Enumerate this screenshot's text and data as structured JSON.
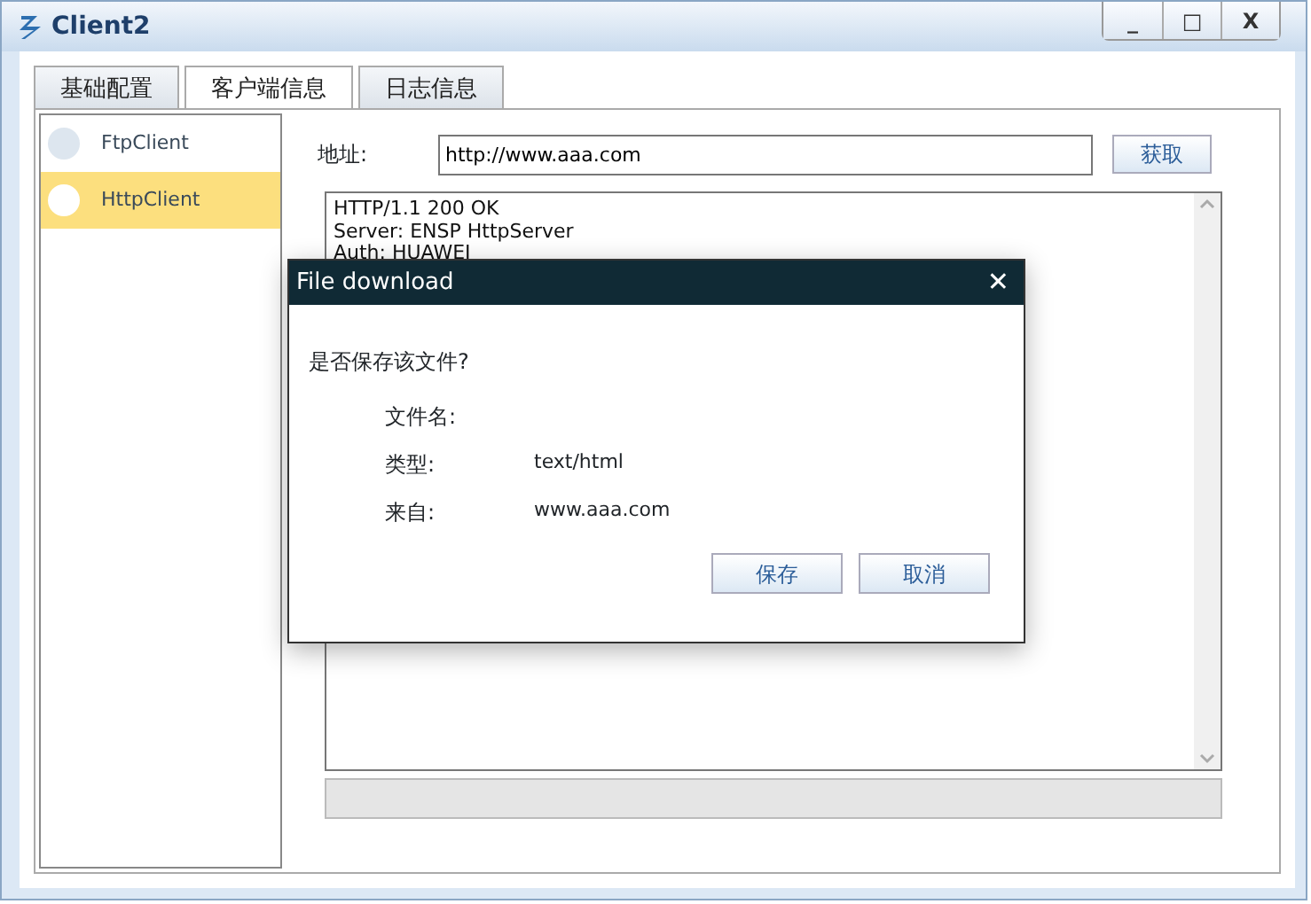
{
  "window": {
    "title": "Client2",
    "controls": [
      "_",
      "□",
      "X"
    ]
  },
  "tabs": [
    {
      "label": "基础配置",
      "selected": false
    },
    {
      "label": "客户端信息",
      "selected": true
    },
    {
      "label": "日志信息",
      "selected": false
    }
  ],
  "clients": [
    {
      "label": "FtpClient",
      "selected": false
    },
    {
      "label": "HttpClient",
      "selected": true
    }
  ],
  "address": {
    "label": "地址:",
    "value": "http://www.aaa.com"
  },
  "fetch_button": "获取",
  "progress": {
    "level": 0
  },
  "response_lines": [
    "HTTP/1.1 200 OK",
    "Server: ENSP HttpServer",
    "Auth: HUAWEI"
  ],
  "dialog": {
    "title": "File download",
    "close": "✕",
    "question": "是否保存该文件?",
    "fields": [
      {
        "label": "文件名:"
      },
      {
        "label": "类型:",
        "value": "text/html"
      },
      {
        "label": "来自:",
        "value": "www.aaa.com"
      }
    ],
    "buttons": [
      "保存",
      "取消"
    ]
  }
}
